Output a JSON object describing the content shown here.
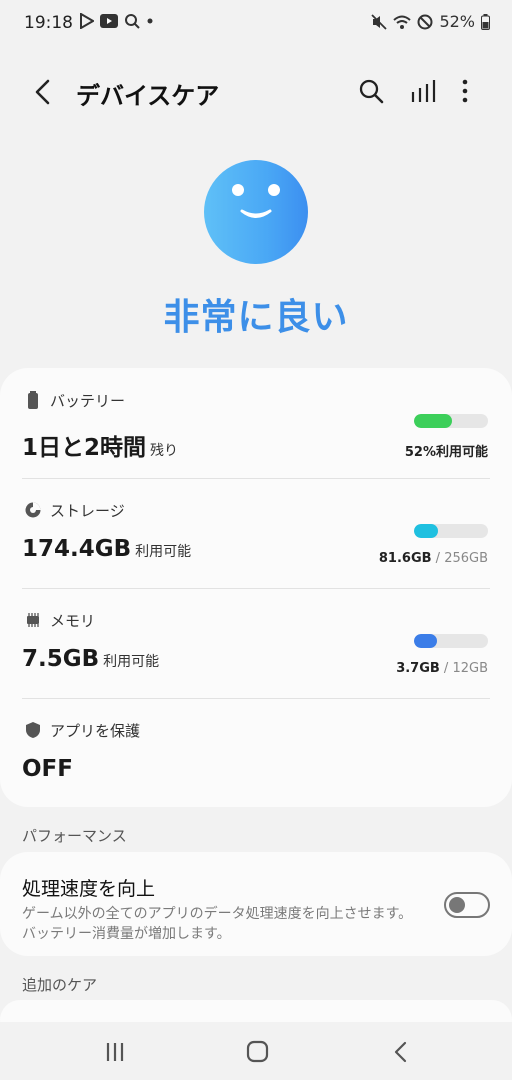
{
  "status_bar": {
    "time": "19:18",
    "left_icons": [
      "play-store-icon",
      "youtube-icon",
      "assistant-icon",
      "notification-dot-icon"
    ],
    "right_icons": [
      "mute-icon",
      "wifi-icon",
      "do-not-disturb-icon",
      "battery-icon"
    ],
    "battery_percent": "52%"
  },
  "header": {
    "title": "デバイスケア",
    "actions": [
      "search-icon",
      "stats-icon",
      "more-icon"
    ]
  },
  "hero": {
    "status_text": "非常に良い",
    "accent_color": "#3d8fe8"
  },
  "battery": {
    "label": "バッテリー",
    "value": "1日と2時間",
    "suffix": "残り",
    "right_text": "52%利用可能",
    "level_fraction": 0.52,
    "bar_color": "#3ccf5a"
  },
  "storage": {
    "label": "ストレージ",
    "value": "174.4GB",
    "suffix": "利用可能",
    "used": "81.6GB",
    "separator": " / ",
    "total": "256GB",
    "used_fraction": 0.32,
    "bar_color": "#1fc0e0"
  },
  "memory": {
    "label": "メモリ",
    "value": "7.5GB",
    "suffix": "利用可能",
    "used": "3.7GB",
    "separator": " / ",
    "total": "12GB",
    "used_fraction": 0.31,
    "bar_color": "#3b7de8"
  },
  "app_protection": {
    "label": "アプリを保護",
    "value": "OFF"
  },
  "performance": {
    "heading": "パフォーマンス",
    "title": "処理速度を向上",
    "description": "ゲーム以外の全てのアプリのデータ処理速度を向上させます。バッテリー消費量が増加します。",
    "toggle_on": false
  },
  "additional_care": {
    "heading": "追加のケア"
  },
  "nav": {
    "buttons": [
      "recents-icon",
      "home-icon",
      "back-icon"
    ]
  }
}
